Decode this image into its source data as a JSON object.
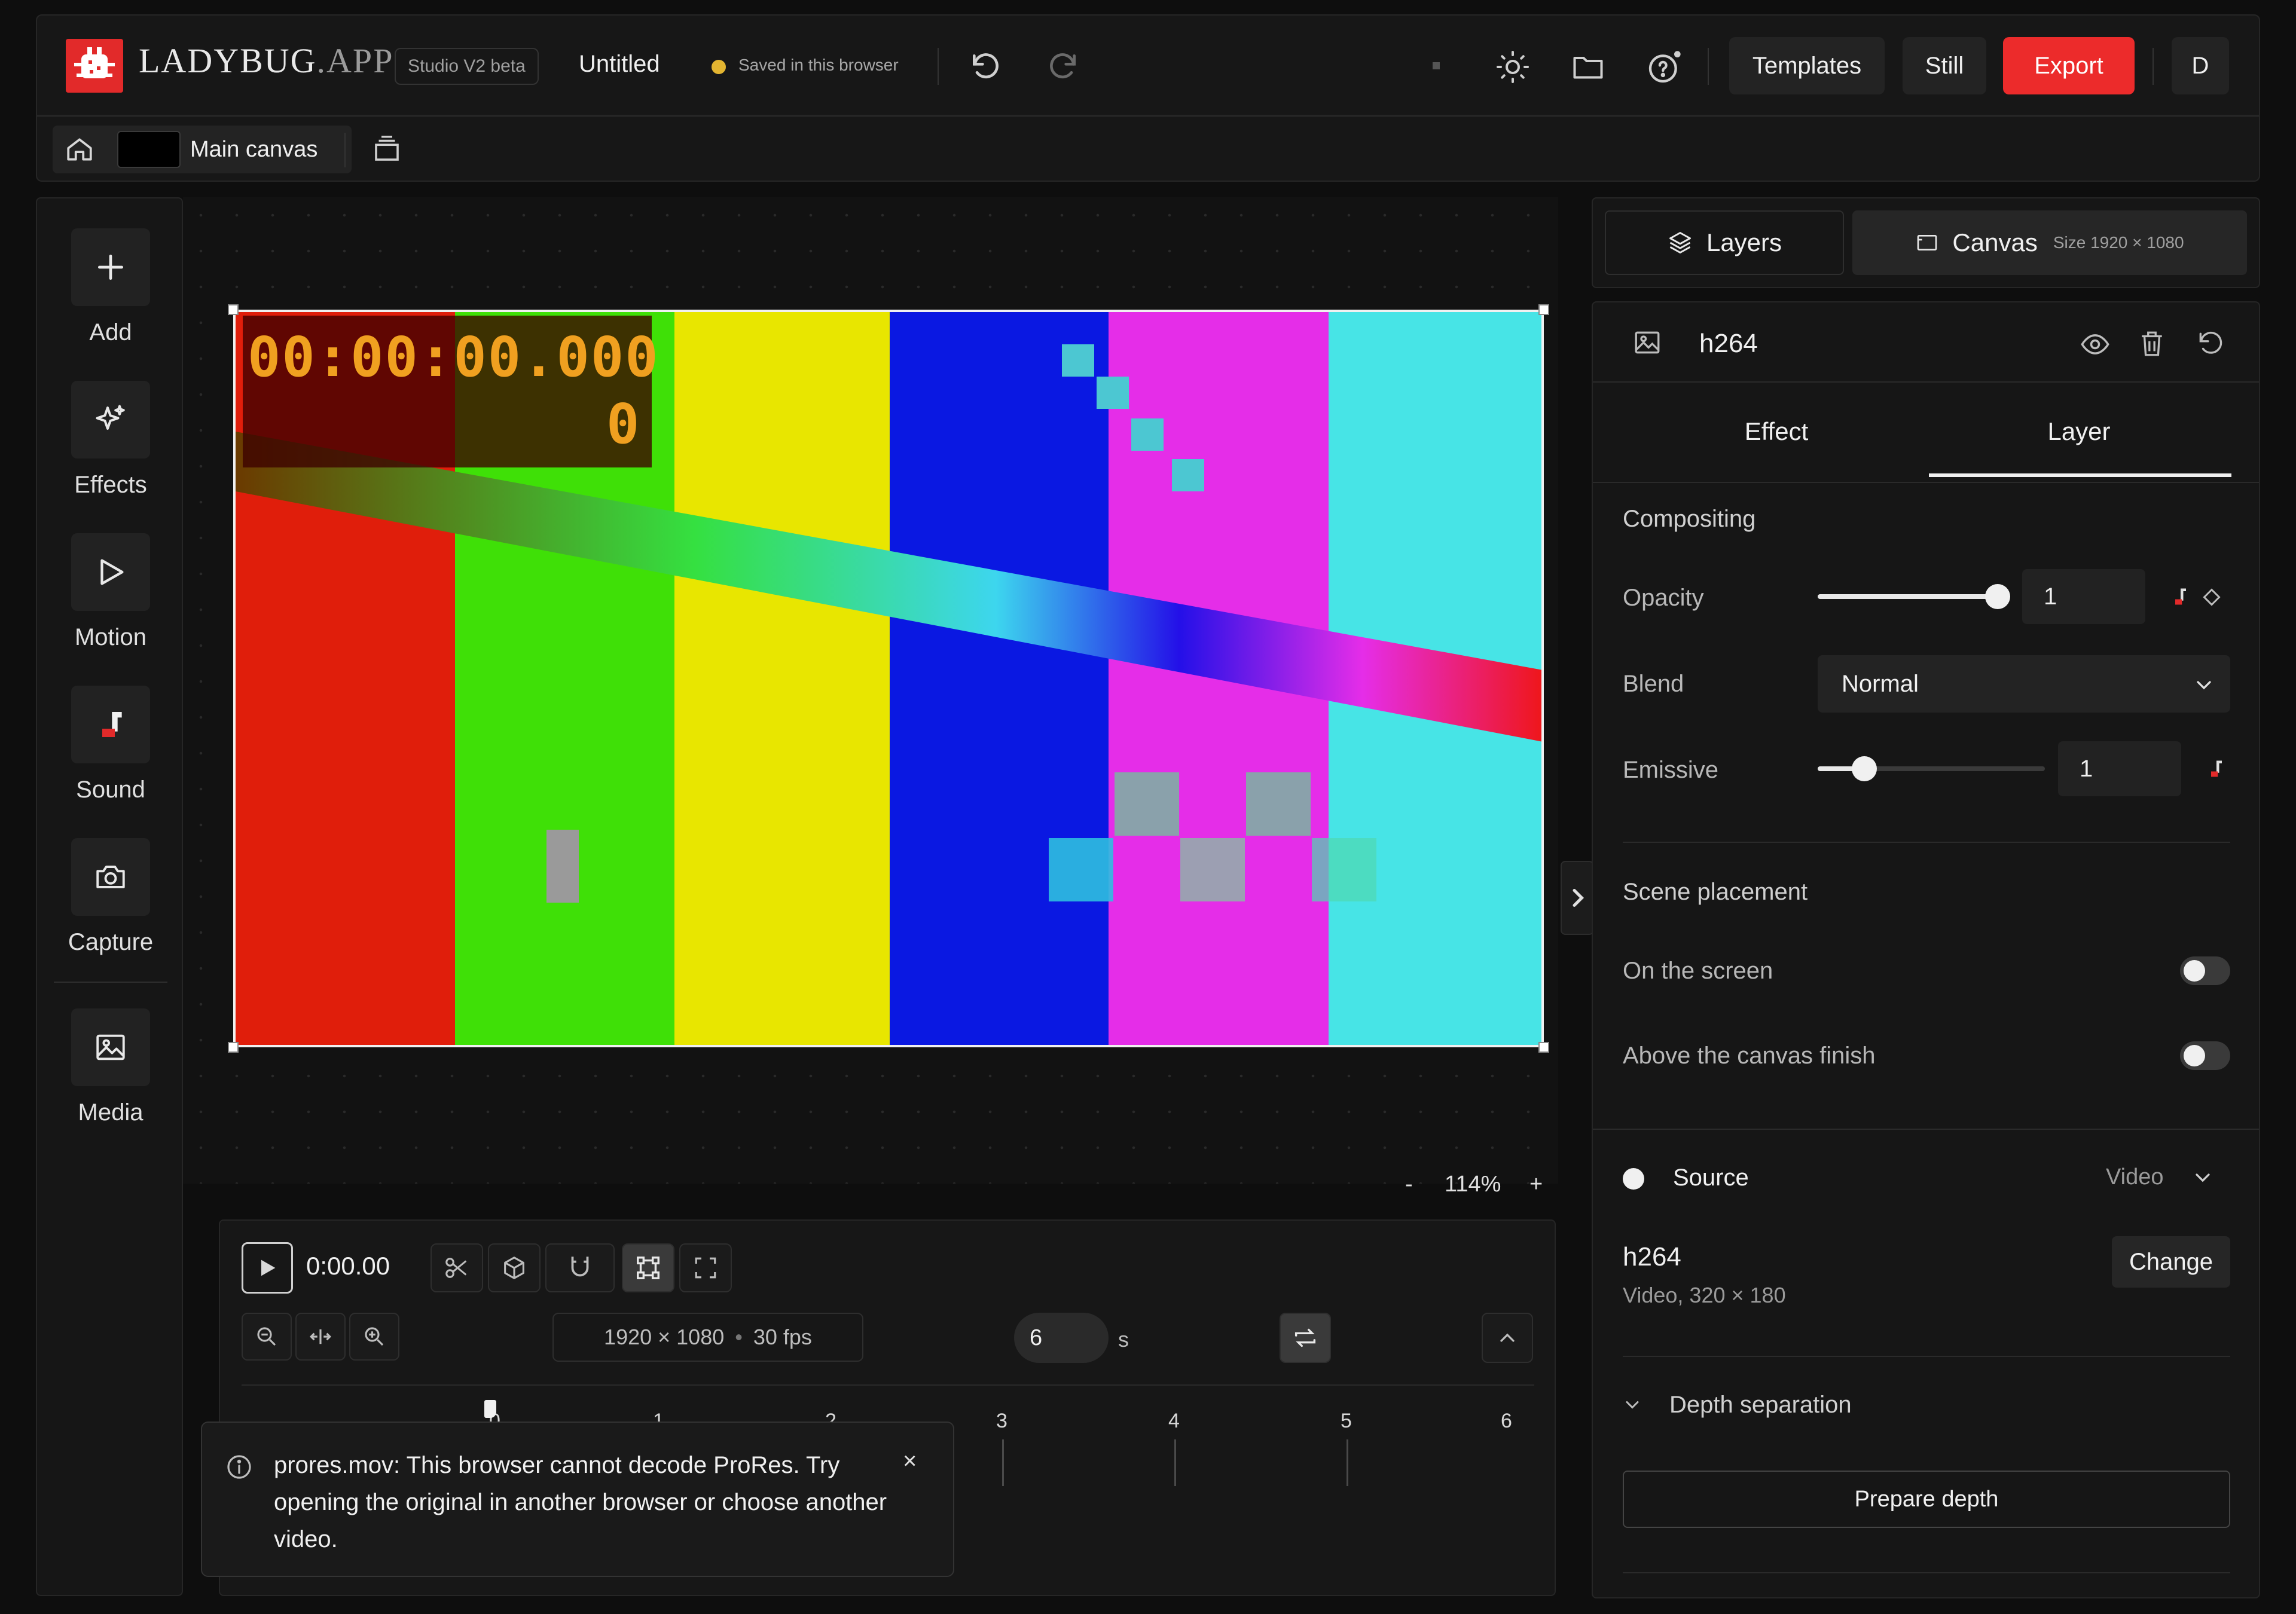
{
  "topbar": {
    "logo": "LADYBUG",
    "logo_suffix": ".APP",
    "badge": "Studio V2 beta",
    "doc_title": "Untitled",
    "save_status": "Saved in this browser",
    "templates_label": "Templates",
    "still_label": "Still",
    "export_label": "Export",
    "avatar_letter": "D",
    "colors": {
      "accent": "#ec2b2b",
      "saved_dot": "#e3b531"
    }
  },
  "subbar": {
    "canvas_name": "Main canvas"
  },
  "sidebar": {
    "items": [
      {
        "label": "Add",
        "icon": "plus-icon"
      },
      {
        "label": "Effects",
        "icon": "sparkles-icon"
      },
      {
        "label": "Motion",
        "icon": "play-icon"
      },
      {
        "label": "Sound",
        "icon": "music-note-icon"
      },
      {
        "label": "Capture",
        "icon": "camera-icon"
      },
      {
        "label": "Media",
        "icon": "image-icon"
      }
    ]
  },
  "canvas": {
    "timecode_overlay": "00:00:00.000",
    "frame_counter": "0",
    "zoom_minus": "-",
    "zoom_level": "114%",
    "zoom_plus": "+",
    "bar_colors": [
      "#e01e0b",
      "#3fe007",
      "#e8e600",
      "#0a18e2",
      "#e52de8",
      "#47e4e6"
    ]
  },
  "timeline": {
    "current_time": "0:00.00",
    "resolution": "1920 × 1080",
    "separator": "•",
    "fps": "30 fps",
    "duration_value": "6",
    "duration_unit": "s",
    "ruler": [
      "0",
      "1",
      "2",
      "3",
      "4",
      "5",
      "6"
    ]
  },
  "toast": {
    "message": "prores.mov: This browser cannot decode ProRes. Try opening the original in another browser or choose another video.",
    "close": "×"
  },
  "right_panel": {
    "tab_layers": "Layers",
    "tab_canvas": "Canvas",
    "canvas_size": "Size 1920 × 1080",
    "layer_name": "h264",
    "subtab_effect": "Effect",
    "subtab_layer": "Layer",
    "compositing_title": "Compositing",
    "opacity_label": "Opacity",
    "opacity_value": "1",
    "opacity_fraction": 1.0,
    "blend_label": "Blend",
    "blend_value": "Normal",
    "emissive_label": "Emissive",
    "emissive_value": "1",
    "emissive_fraction": 0.17,
    "scene_title": "Scene placement",
    "on_screen_label": "On the screen",
    "on_screen": false,
    "above_finish_label": "Above the canvas finish",
    "above_finish": false,
    "source_label": "Source",
    "source_type": "Video",
    "source_name": "h264",
    "source_meta": "Video, 320 × 180",
    "change_label": "Change",
    "depth_title": "Depth separation",
    "prepare_depth_label": "Prepare depth"
  }
}
